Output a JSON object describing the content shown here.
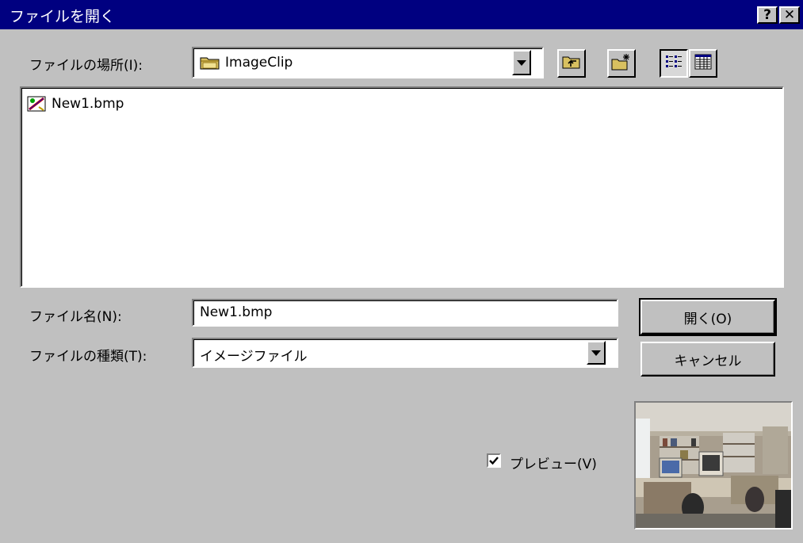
{
  "window": {
    "title": "ファイルを開く",
    "help_label": "?",
    "close_label": "✕"
  },
  "location": {
    "label": "ファイルの場所(I):",
    "value": "ImageClip"
  },
  "toolbar": {
    "up_icon": "folder-up-icon",
    "new_folder_icon": "new-folder-icon",
    "list_view_icon": "list-view-icon",
    "details_view_icon": "details-view-icon"
  },
  "files": [
    {
      "name": "New1.bmp",
      "icon": "bitmap-file-icon"
    }
  ],
  "filename": {
    "label": "ファイル名(N):",
    "value": "New1.bmp"
  },
  "filetype": {
    "label": "ファイルの種類(T):",
    "value": "イメージファイル"
  },
  "buttons": {
    "open": "開く(O)",
    "cancel": "キャンセル"
  },
  "preview": {
    "checkbox_label": "プレビュー(V)",
    "checked": true
  },
  "colors": {
    "title_bar": "#000080",
    "face": "#c0c0c0"
  }
}
